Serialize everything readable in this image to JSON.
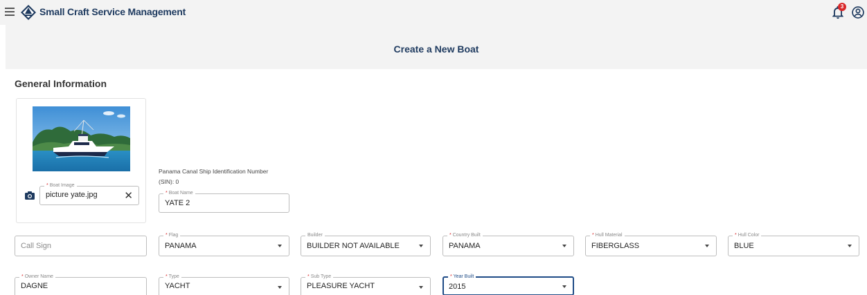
{
  "app": {
    "title": "Small Craft Service Management",
    "notification_count": "3"
  },
  "page": {
    "title": "Create a New Boat"
  },
  "section": {
    "general_title": "General Information"
  },
  "boat_image": {
    "label": "Boat Image",
    "value": "picture yate.jpg"
  },
  "sin": {
    "line1": "Panama Canal Ship Identification Number",
    "line2": "(SIN): 0"
  },
  "boat_name": {
    "label": "Boat Name",
    "value": "YATE 2"
  },
  "call_sign": {
    "placeholder": "Call Sign"
  },
  "flag": {
    "label": "Flag",
    "value": "PANAMA"
  },
  "builder": {
    "label": "Builder",
    "value": "BUILDER NOT AVAILABLE"
  },
  "country_built": {
    "label": "Country Built",
    "value": "PANAMA"
  },
  "hull_material": {
    "label": "Hull Material",
    "value": "FIBERGLASS"
  },
  "hull_color": {
    "label": "Hull Color",
    "value": "BLUE"
  },
  "owner_name": {
    "label": "Owner Name",
    "value": "DAGNE"
  },
  "type": {
    "label": "Type",
    "value": "YACHT"
  },
  "sub_type": {
    "label": "Sub Type",
    "value": "PLEASURE YACHT"
  },
  "year_built": {
    "label": "Year Built",
    "value": "2015"
  },
  "required_marker": "*",
  "icons": {
    "menu": "menu-icon",
    "logo": "compass-logo-icon",
    "bell": "bell-icon",
    "account": "account-circle-icon",
    "camera": "camera-icon",
    "clear": "close-icon",
    "dropdown": "chevron-down-icon"
  },
  "colors": {
    "brand_navy": "#1e3a5f",
    "badge_red": "#d9292b",
    "focus_blue": "#1e4b86"
  }
}
